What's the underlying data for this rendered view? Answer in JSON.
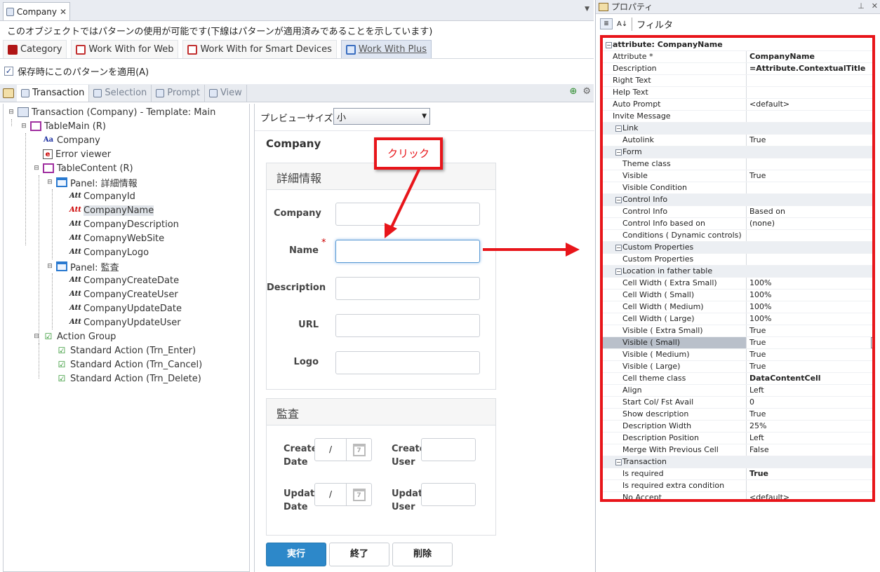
{
  "doc_tab": {
    "label": "Company",
    "close": "✕"
  },
  "notice": "このオブジェクトではパターンの使用が可能です(下線はパターンが適用済みであることを示しています)",
  "pattern_tabs": [
    {
      "label": "Category",
      "color": "#b01515"
    },
    {
      "label": "Work With for Web",
      "color": "#c23030"
    },
    {
      "label": "Work With for Smart Devices",
      "color": "#c23030"
    },
    {
      "label": "Work With Plus",
      "color": "#3a6ec0"
    }
  ],
  "apply_on_save": {
    "label": "保存時にこのパターンを適用(A)",
    "checked": true
  },
  "sub_tabs": [
    "Transaction",
    "Selection",
    "Prompt",
    "View"
  ],
  "tree": [
    {
      "label": "Transaction (Company) - Template: Main",
      "icon": "transaction-icon",
      "box": "⊟"
    },
    {
      "label": "TableMain (R)",
      "icon": "table-icon",
      "box": "⊟"
    },
    {
      "label": "Company",
      "icon": "text-icon",
      "box": ""
    },
    {
      "label": "Error viewer",
      "icon": "error-viewer-icon",
      "box": ""
    },
    {
      "label": "TableContent (R)",
      "icon": "table-icon",
      "box": "⊟"
    },
    {
      "label": "Panel: 詳細情報",
      "icon": "panel-icon",
      "box": "⊟"
    },
    {
      "label": "CompanyId",
      "icon": "attribute-icon",
      "box": ""
    },
    {
      "label": "CompanyName",
      "icon": "attribute-icon",
      "box": ""
    },
    {
      "label": "CompanyDescription",
      "icon": "attribute-icon",
      "box": ""
    },
    {
      "label": "ComapnyWebSite",
      "icon": "attribute-icon",
      "box": ""
    },
    {
      "label": "CompanyLogo",
      "icon": "attribute-icon",
      "box": ""
    },
    {
      "label": "Panel: 監査",
      "icon": "panel-icon",
      "box": "⊟"
    },
    {
      "label": "CompanyCreateDate",
      "icon": "attribute-icon",
      "box": ""
    },
    {
      "label": "CompanyCreateUser",
      "icon": "attribute-icon",
      "box": ""
    },
    {
      "label": "CompanyUpdateDate",
      "icon": "attribute-icon",
      "box": ""
    },
    {
      "label": "CompanyUpdateUser",
      "icon": "attribute-icon",
      "box": ""
    },
    {
      "label": "Action Group",
      "icon": "action-group-icon",
      "box": "⊟"
    },
    {
      "label": "Standard Action (Trn_Enter)",
      "icon": "action-icon",
      "box": ""
    },
    {
      "label": "Standard Action (Trn_Cancel)",
      "icon": "action-icon",
      "box": ""
    },
    {
      "label": "Standard Action (Trn_Delete)",
      "icon": "action-icon",
      "box": ""
    }
  ],
  "preview": {
    "size_label": "プレビューサイズ",
    "size_value": "小",
    "title": "Company",
    "panel1": {
      "title": "詳細情報",
      "fields": [
        "Company",
        "Name",
        "Description",
        "URL",
        "Logo"
      ],
      "required_mark": "*"
    },
    "panel2": {
      "title": "監査",
      "create_date": "Create Date",
      "create_user": "Create User",
      "update_date": "Update Date",
      "update_user": "Update User",
      "date_sep": "/",
      "cal_day": "7"
    },
    "buttons": {
      "run": "実行",
      "end": "終了",
      "delete": "削除"
    }
  },
  "callout": "クリック",
  "properties": {
    "title": "プロパティ",
    "filter": "フィルタ",
    "rows": [
      {
        "k": "attribute: CompanyName",
        "v": "",
        "type": "hdr"
      },
      {
        "k": "Attribute *",
        "v": "CompanyName",
        "bold": true
      },
      {
        "k": "Description",
        "v": "=Attribute.ContextualTitle",
        "bold": true
      },
      {
        "k": "Right Text",
        "v": ""
      },
      {
        "k": "Help Text",
        "v": ""
      },
      {
        "k": "Auto Prompt",
        "v": "<default>"
      },
      {
        "k": "Invite Message",
        "v": ""
      },
      {
        "k": "Link",
        "v": "",
        "type": "cat"
      },
      {
        "k": "Autolink",
        "v": "True",
        "type": "sub"
      },
      {
        "k": "Form",
        "v": "",
        "type": "cat"
      },
      {
        "k": "Theme class",
        "v": "",
        "type": "sub"
      },
      {
        "k": "Visible",
        "v": "True",
        "type": "sub"
      },
      {
        "k": "Visible Condition",
        "v": "",
        "type": "sub"
      },
      {
        "k": "Control Info",
        "v": "",
        "type": "cat"
      },
      {
        "k": "Control Info",
        "v": "Based on",
        "type": "sub"
      },
      {
        "k": "Control Info based on",
        "v": "(none)",
        "type": "sub"
      },
      {
        "k": "Conditions ( Dynamic controls)",
        "v": "",
        "type": "sub"
      },
      {
        "k": "Custom Properties",
        "v": "",
        "type": "cat"
      },
      {
        "k": "Custom Properties",
        "v": "",
        "type": "sub"
      },
      {
        "k": "Location in father table",
        "v": "",
        "type": "cat"
      },
      {
        "k": "Cell Width ( Extra Small)",
        "v": "100%",
        "type": "sub"
      },
      {
        "k": "Cell Width ( Small)",
        "v": "100%",
        "type": "sub"
      },
      {
        "k": "Cell Width ( Medium)",
        "v": "100%",
        "type": "sub"
      },
      {
        "k": "Cell Width ( Large)",
        "v": "100%",
        "type": "sub"
      },
      {
        "k": "Visible ( Extra Small)",
        "v": "True",
        "type": "sub"
      },
      {
        "k": "Visible ( Small)",
        "v": "True",
        "type": "sub",
        "sel": true
      },
      {
        "k": "Visible ( Medium)",
        "v": "True",
        "type": "sub"
      },
      {
        "k": "Visible ( Large)",
        "v": "True",
        "type": "sub"
      },
      {
        "k": "Cell theme class",
        "v": "DataContentCell",
        "type": "sub",
        "bold": true
      },
      {
        "k": "Align",
        "v": "Left",
        "type": "sub"
      },
      {
        "k": "Start Col/ Fst Avail",
        "v": "0",
        "type": "sub"
      },
      {
        "k": "Show description",
        "v": "True",
        "type": "sub"
      },
      {
        "k": "Description Width",
        "v": "25%",
        "type": "sub"
      },
      {
        "k": "Description Position",
        "v": "Left",
        "type": "sub"
      },
      {
        "k": "Merge With Previous Cell",
        "v": "False",
        "type": "sub"
      },
      {
        "k": "Transaction",
        "v": "",
        "type": "cat"
      },
      {
        "k": "Is required",
        "v": "True",
        "type": "sub",
        "bold": true
      },
      {
        "k": "Is required extra condition",
        "v": "",
        "type": "sub"
      },
      {
        "k": "No Accept",
        "v": "<default>",
        "type": "sub"
      }
    ]
  },
  "colors": {
    "highlight_red": "#e8151a",
    "primary_blue": "#2d88c9"
  }
}
